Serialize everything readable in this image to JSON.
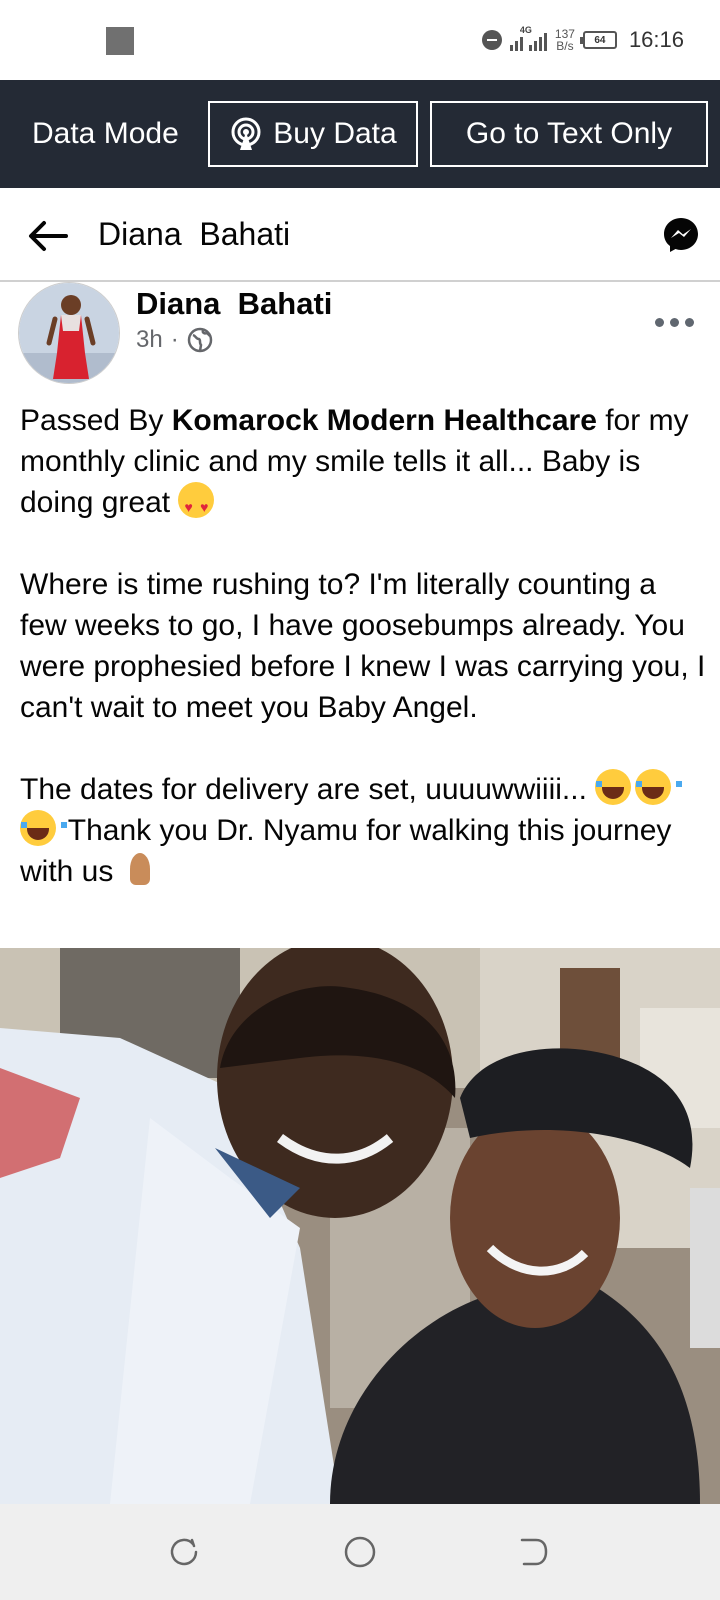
{
  "status_bar": {
    "network": "4G",
    "speed_value": "137",
    "speed_unit": "B/s",
    "battery": "64",
    "time": "16:16"
  },
  "data_bar": {
    "mode_label": "Data Mode",
    "buy_data_label": "Buy Data",
    "text_only_label": "Go to Text Only",
    "background": "#242a35"
  },
  "header": {
    "title": "Diana  Bahati",
    "back_icon": "arrow-left-icon",
    "messenger_icon": "messenger-icon"
  },
  "post": {
    "author": "Diana  Bahati",
    "time": "3h",
    "separator": "·",
    "privacy_icon": "globe-icon",
    "paragraph1": {
      "before": "Passed By ",
      "bold": "Komarock Modern Healthcare",
      "after": "  for my monthly clinic and my smile tells it all... Baby is doing great "
    },
    "paragraph2": "Where is time rushing to? I'm literally counting a few weeks to go, I have goosebumps already. You were prophesied before I knew I was carrying you, I can't wait to meet you Baby Angel.",
    "paragraph3": {
      "before": "The dates for delivery are set, uuuuwwiiii... ",
      "after": " Thank you Dr. Nyamu for walking this journey with us "
    }
  },
  "nav_bar": {
    "icons": [
      "recent-apps-icon",
      "home-icon",
      "back-icon"
    ]
  }
}
